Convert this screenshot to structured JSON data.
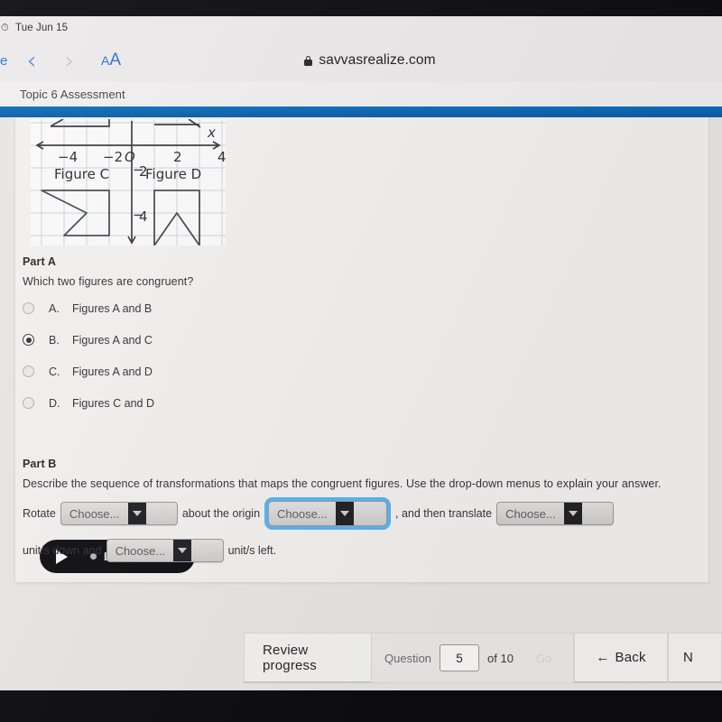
{
  "device": {
    "status_bar": {
      "wifi_icon": "wifi-icon",
      "date": "Tue Jun 15"
    }
  },
  "browser": {
    "tab_stub_label": "e",
    "back_icon": "chevron-left-icon",
    "forward_icon": "chevron-right-icon",
    "text_size_small": "A",
    "text_size_large": "A",
    "lock_icon": "lock-icon",
    "url": "savvasrealize.com",
    "page_tab_title": "Topic 6 Assessment"
  },
  "figure": {
    "axis_label_x": "x",
    "origin_label": "O",
    "x_ticks": [
      "-4",
      "-2",
      "2",
      "4"
    ],
    "y_ticks": [
      "2",
      "4"
    ],
    "shape_labels": [
      "Figure C",
      "Figure D"
    ]
  },
  "partA": {
    "label": "Part A",
    "question": "Which two figures are congruent?",
    "choices": [
      {
        "letter": "A.",
        "text": "Figures A and B",
        "selected": false
      },
      {
        "letter": "B.",
        "text": "Figures A and C",
        "selected": true
      },
      {
        "letter": "C.",
        "text": "Figures A and D",
        "selected": false
      },
      {
        "letter": "D.",
        "text": "Figures C and D",
        "selected": false
      }
    ]
  },
  "live_button": {
    "play_icon": "play-icon",
    "dot_icon": "record-dot-icon",
    "label": "LIVE"
  },
  "partB": {
    "label": "Part B",
    "question": "Describe the sequence of transformations that maps the congruent figures. Use the drop-down menus to explain your answer.",
    "sentence": {
      "lead": "Rotate",
      "mid1": "about the origin",
      "mid2": ", and then translate",
      "tail1": "unit/s down and",
      "tail2": "unit/s left."
    },
    "dropdowns": [
      {
        "value": "Choose...",
        "focused": false
      },
      {
        "value": "Choose...",
        "focused": true
      },
      {
        "value": "Choose...",
        "focused": false
      },
      {
        "value": "Choose...",
        "focused": false
      }
    ]
  },
  "bottom_nav": {
    "review_progress": "Review progress",
    "question_label": "Question",
    "question_number": "5",
    "of_total": "of 10",
    "go_label": "Go",
    "back_icon": "arrow-left-icon",
    "back_label": "Back",
    "next_label": "N"
  }
}
